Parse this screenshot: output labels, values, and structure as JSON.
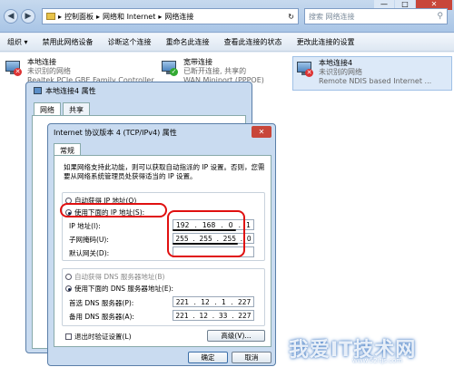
{
  "address": {
    "crumbs": [
      "控制面板",
      "网络和 Internet",
      "网络连接"
    ],
    "sep": "▸",
    "refresh": "↻"
  },
  "search": {
    "placeholder": "搜索 网络连接",
    "icon": "magnifier"
  },
  "window_controls": {
    "minimize": "—",
    "maximize": "□",
    "close": "✕"
  },
  "toolbar": {
    "organize": "组织 ▾",
    "disable": "禁用此网络设备",
    "diagnose": "诊断这个连接",
    "rename": "重命名此连接",
    "status": "查看此连接的状态",
    "settings": "更改此连接的设置"
  },
  "connections": [
    {
      "name": "本地连接",
      "status": "未识别的网络",
      "device": "Realtek PCIe GBE Family Controller"
    },
    {
      "name": "宽带连接",
      "status": "已断开连接, 共享的",
      "device": "WAN Miniport (PPPOE)"
    },
    {
      "name": "本地连接4",
      "status": "未识别的网络",
      "device": "Remote NDIS based Internet ..."
    }
  ],
  "back_dialog": {
    "title": "本地连接4 属性",
    "tabs": [
      "网络",
      "共享"
    ]
  },
  "dialog": {
    "title": "Internet 协议版本 4 (TCP/IPv4) 属性",
    "close": "✕",
    "tab": "常规",
    "description": "如果网络支持此功能，则可以获取自动指派的 IP 设置。否则，您需要从网络系统管理员处获得适当的 IP 设置。",
    "auto_ip": "自动获得 IP 地址(O)",
    "manual_ip": "使用下面的 IP 地址(S):",
    "ip_label": "IP 地址(I):",
    "mask_label": "子网掩码(U):",
    "gateway_label": "默认网关(D):",
    "ip": [
      "192",
      ".",
      "168",
      ".",
      "0",
      ".",
      "1"
    ],
    "mask": [
      "255",
      ".",
      "255",
      ".",
      "255",
      ".",
      "0"
    ],
    "auto_dns": "自动获得 DNS 服务器地址(B)",
    "manual_dns": "使用下面的 DNS 服务器地址(E):",
    "dns1_label": "首选 DNS 服务器(P):",
    "dns2_label": "备用 DNS 服务器(A):",
    "dns1": [
      "221",
      ".",
      "12",
      ".",
      "1",
      ".",
      "227"
    ],
    "dns2": [
      "221",
      ".",
      "12",
      ".",
      "33",
      ".",
      "227"
    ],
    "validate": "退出时验证设置(L)",
    "advanced": "高级(V)...",
    "ok": "确定",
    "cancel": "取消"
  },
  "watermark": {
    "text": "我爱IT技术网",
    "url": "www.52itjs.com"
  },
  "colors": {
    "highlight": "#e01010",
    "title_bg": "#c9dbf0"
  }
}
